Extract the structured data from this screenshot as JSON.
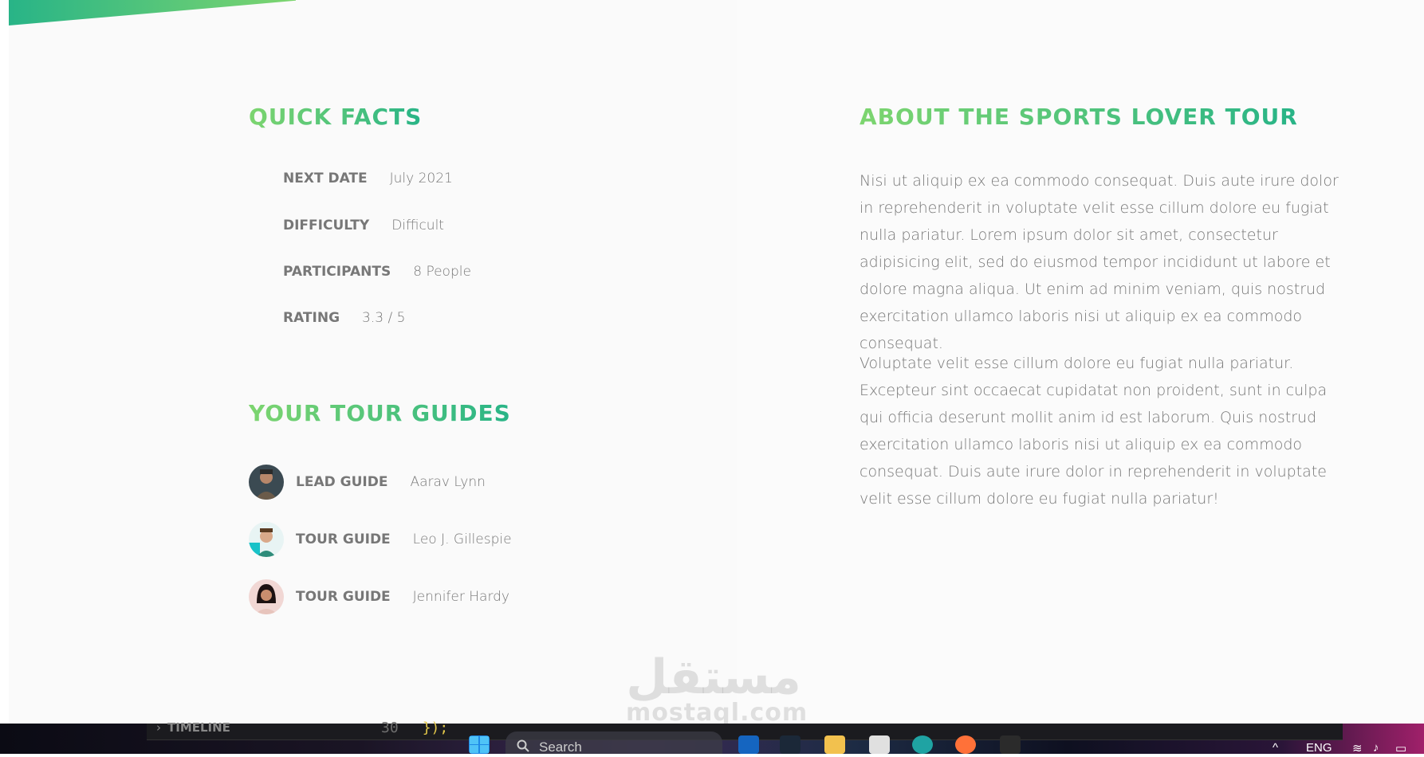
{
  "quick_facts": {
    "heading": "QUICK FACTS",
    "items": [
      {
        "label": "NEXT DATE",
        "value": "July 2021",
        "icon": "calendar-icon"
      },
      {
        "label": "DIFFICULTY",
        "value": "Difficult",
        "icon": "trending-up-icon"
      },
      {
        "label": "PARTICIPANTS",
        "value": "8 People",
        "icon": "user-icon"
      },
      {
        "label": "RATING",
        "value": "3.3 / 5",
        "icon": "star-icon"
      }
    ]
  },
  "guides": {
    "heading": "YOUR TOUR GUIDES",
    "items": [
      {
        "role": "LEAD GUIDE",
        "name": "Aarav Lynn"
      },
      {
        "role": "TOUR GUIDE",
        "name": "Leo J. Gillespie"
      },
      {
        "role": "TOUR GUIDE",
        "name": "Jennifer Hardy"
      }
    ]
  },
  "about": {
    "heading": "ABOUT THE SPORTS LOVER TOUR",
    "paragraphs": [
      "Nisi ut aliquip ex ea commodo consequat. Duis aute irure dolor in reprehenderit in voluptate velit esse cillum dolore eu fugiat nulla pariatur. Lorem ipsum dolor sit amet, consectetur adipisicing elit, sed do eiusmod tempor incididunt ut labore et dolore magna aliqua. Ut enim ad minim veniam, quis nostrud exercitation ullamco laboris nisi ut aliquip ex ea commodo consequat.",
      "Voluptate velit esse cillum dolore eu fugiat nulla pariatur. Excepteur sint occaecat cupidatat non proident, sunt in culpa qui officia deserunt mollit anim id est laborum. Quis nostrud exercitation ullamco laboris nisi ut aliquip ex ea commodo consequat. Duis aute irure dolor in reprehenderit in voluptate velit esse cillum dolore eu fugiat nulla pariatur!"
    ]
  },
  "watermark": {
    "arabic": "مستقل",
    "latin": "mostaql.com"
  },
  "editor": {
    "timeline_label": "TIMELINE",
    "line_number": "30",
    "code": "});"
  },
  "taskbar": {
    "search_placeholder": "Search",
    "language": "ENG"
  },
  "colors": {
    "accent_light": "#7dd56f",
    "accent_dark": "#28b487",
    "text": "#777777"
  }
}
